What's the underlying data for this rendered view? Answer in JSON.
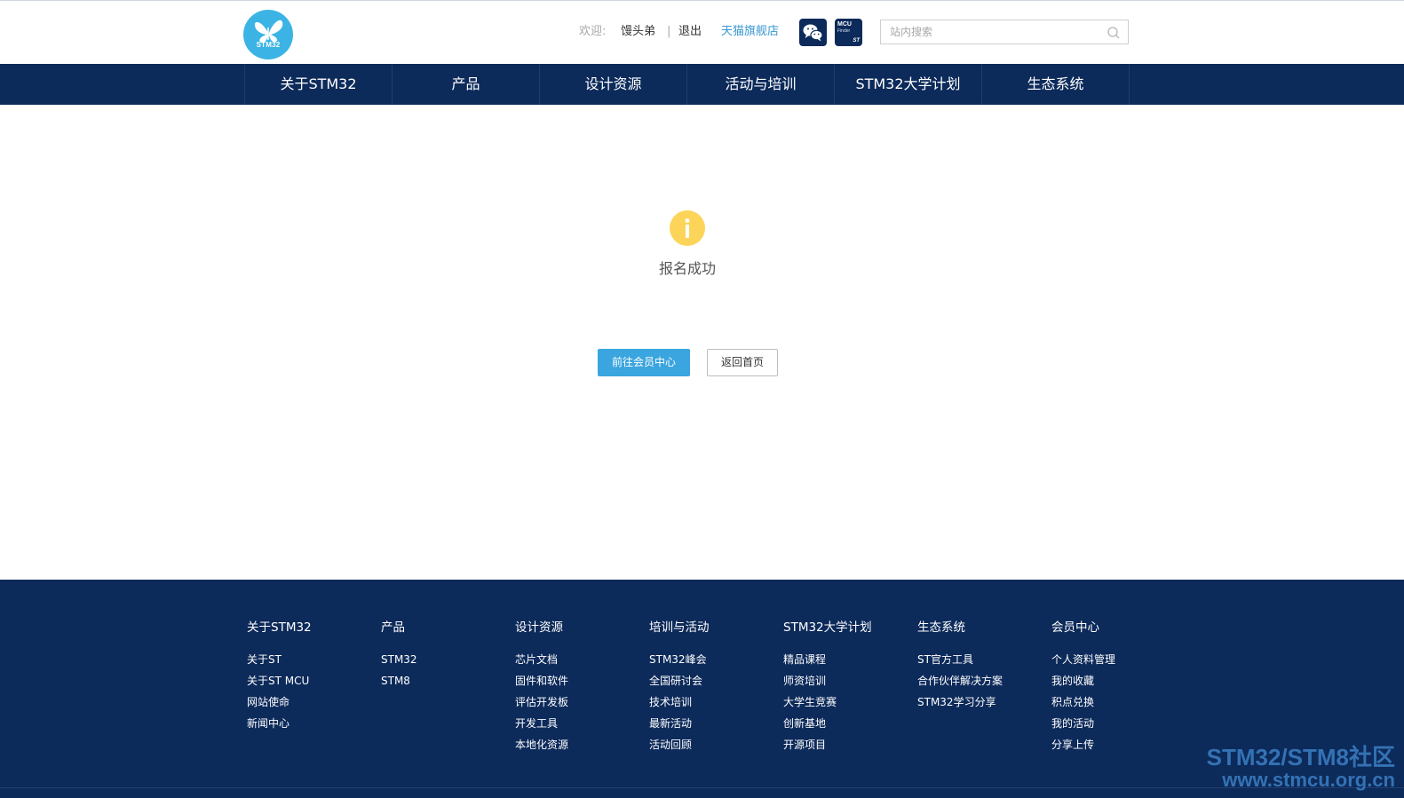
{
  "header": {
    "logo_text": "STM32",
    "welcome_label": "欢迎:",
    "username": "馒头弟",
    "separator": "|",
    "logout": "退出",
    "tmall_store": "天猫旗舰店",
    "wechat_icon": "wechat-icon",
    "mcu_finder": {
      "line1": "MCU",
      "line2": "Finder",
      "brand": "ST"
    },
    "search_placeholder": "站内搜索"
  },
  "nav": {
    "items": [
      "关于STM32",
      "产品",
      "设计资源",
      "活动与培训",
      "STM32大学计划",
      "生态系统"
    ]
  },
  "main": {
    "icon": "info-icon",
    "message": "报名成功",
    "primary_button": "前往会员中心",
    "secondary_button": "返回首页"
  },
  "footer": {
    "columns": [
      {
        "title": "关于STM32",
        "links": [
          "关于ST",
          "关于ST MCU",
          "网站使命",
          "新闻中心"
        ]
      },
      {
        "title": "产品",
        "links": [
          "STM32",
          "STM8"
        ]
      },
      {
        "title": "设计资源",
        "links": [
          "芯片文档",
          "固件和软件",
          "评估开发板",
          "开发工具",
          "本地化资源"
        ]
      },
      {
        "title": "培训与活动",
        "links": [
          "STM32峰会",
          "全国研讨会",
          "技术培训",
          "最新活动",
          "活动回顾"
        ]
      },
      {
        "title": "STM32大学计划",
        "links": [
          "精品课程",
          "师资培训",
          "大学生竞赛",
          "创新基地",
          "开源项目"
        ]
      },
      {
        "title": "生态系统",
        "links": [
          "ST官方工具",
          "合作伙伴解决方案",
          "STM32学习分享"
        ]
      },
      {
        "title": "会员中心",
        "links": [
          "个人资料管理",
          "我的收藏",
          "积点兑换",
          "我的活动",
          "分享上传"
        ]
      }
    ]
  },
  "watermark": {
    "line1": "STM32/STM8社区",
    "line2": "www.stmcu.org.cn"
  },
  "colors": {
    "navy": "#0c2a5a",
    "accent_blue": "#3aa5df",
    "logo_blue": "#3bb4e5",
    "info_yellow": "#fcd45a",
    "tmall_link": "#3a97d0"
  }
}
